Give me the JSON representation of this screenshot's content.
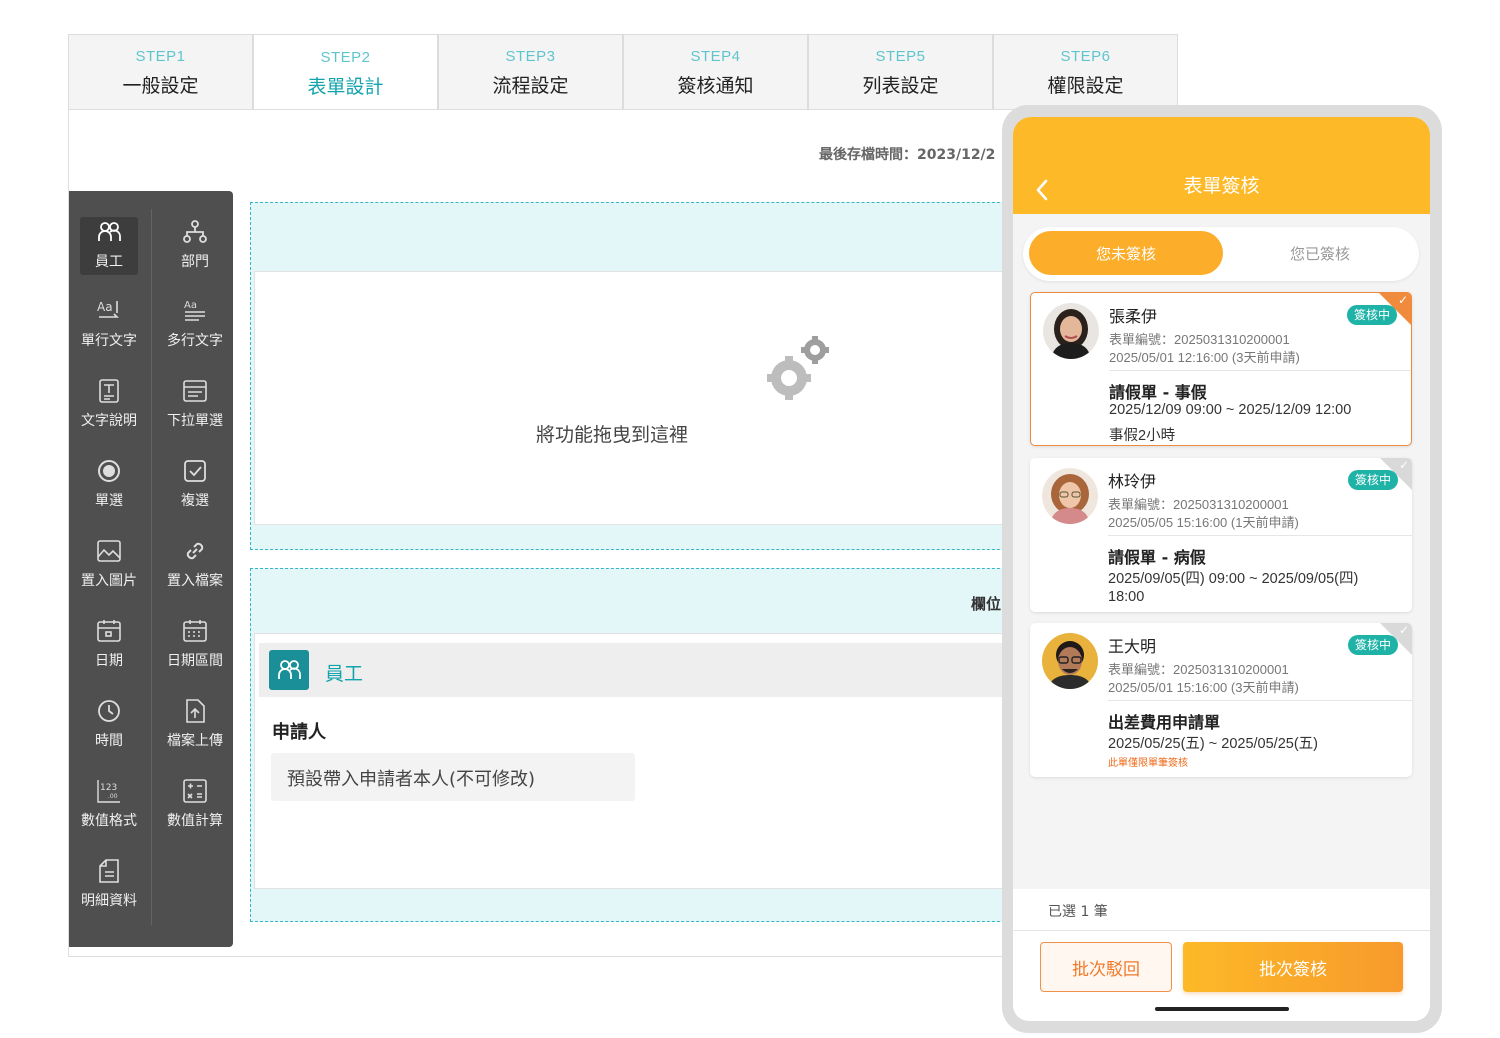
{
  "steps": [
    {
      "step": "STEP1",
      "label": "一般設定"
    },
    {
      "step": "STEP2",
      "label": "表單設計"
    },
    {
      "step": "STEP3",
      "label": "流程設定"
    },
    {
      "step": "STEP4",
      "label": "簽核通知"
    },
    {
      "step": "STEP5",
      "label": "列表設定"
    },
    {
      "step": "STEP6",
      "label": "權限設定"
    }
  ],
  "editor": {
    "save_time": "最後存檔時間：2023/12/2",
    "drop_hint": "將功能拖曳到這裡",
    "column_label": "欄位",
    "employee_label": "員工",
    "applicant_label": "申請人",
    "applicant_value": "預設帶入申請者本人(不可修改)"
  },
  "tools": [
    {
      "label": "員工",
      "icon": "employee-icon"
    },
    {
      "label": "部門",
      "icon": "department-icon"
    },
    {
      "label": "單行文字",
      "icon": "single-line-text-icon"
    },
    {
      "label": "多行文字",
      "icon": "multi-line-text-icon"
    },
    {
      "label": "文字說明",
      "icon": "text-description-icon"
    },
    {
      "label": "下拉單選",
      "icon": "dropdown-icon"
    },
    {
      "label": "單選",
      "icon": "radio-icon"
    },
    {
      "label": "複選",
      "icon": "checkbox-icon"
    },
    {
      "label": "置入圖片",
      "icon": "image-icon"
    },
    {
      "label": "置入檔案",
      "icon": "attachment-icon"
    },
    {
      "label": "日期",
      "icon": "date-icon"
    },
    {
      "label": "日期區間",
      "icon": "date-range-icon"
    },
    {
      "label": "時間",
      "icon": "clock-icon"
    },
    {
      "label": "檔案上傳",
      "icon": "file-upload-icon"
    },
    {
      "label": "數值格式",
      "icon": "number-format-icon"
    },
    {
      "label": "數值計算",
      "icon": "calculator-icon"
    },
    {
      "label": "明細資料",
      "icon": "detail-data-icon"
    }
  ],
  "phone": {
    "title": "表單簽核",
    "tab_pending": "您未簽核",
    "tab_done": "您已簽核",
    "cards": [
      {
        "name": "張柔伊",
        "badge": "簽核中",
        "form_no": "表單編號：2025031310200001",
        "applied": "2025/05/01 12:16:00 (3天前申請)",
        "type": "請假單 - 事假",
        "line1": "2025/12/09 09:00 ~ 2025/12/09 12:00",
        "line2": "事假2小時",
        "note": ""
      },
      {
        "name": "林玲伊",
        "badge": "簽核中",
        "form_no": "表單編號：2025031310200001",
        "applied": "2025/05/05 15:16:00 (1天前申請)",
        "type": "請假單 - 病假",
        "line1": "2025/09/05(四) 09:00 ~ 2025/09/05(四)",
        "line2": "18:00",
        "note": ""
      },
      {
        "name": "王大明",
        "badge": "簽核中",
        "form_no": "表單編號：2025031310200001",
        "applied": "2025/05/01 15:16:00 (3天前申請)",
        "type": "出差費用申請單",
        "line1": "2025/05/25(五) ~ 2025/05/25(五)",
        "line2": "",
        "note": "此單僅限單筆簽核"
      }
    ],
    "selected_count": "已選 1 筆",
    "reject_button": "批次駁回",
    "approve_button": "批次簽核"
  },
  "colors": {
    "teal": "#12a3ad",
    "orange": "#fdb927",
    "badge": "#1fb3a8"
  }
}
